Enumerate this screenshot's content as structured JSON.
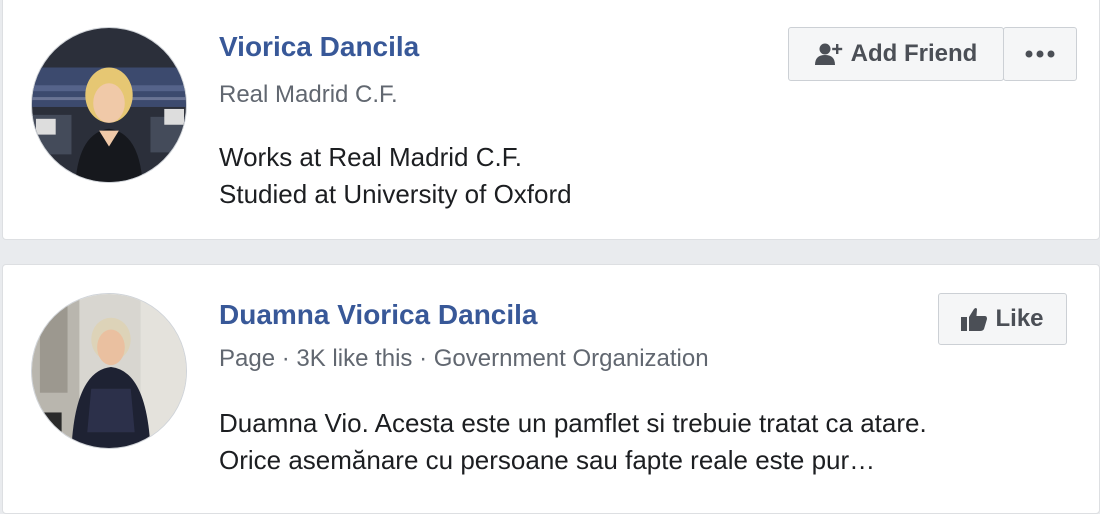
{
  "results": [
    {
      "name": "Viorica Dancila",
      "subtitle": "Real Madrid C.F.",
      "details": [
        "Works at Real Madrid C.F.",
        "Studied at University of Oxford"
      ],
      "action_label": "Add Friend",
      "action_icon": "add-friend-icon",
      "more_icon": "more-icon"
    },
    {
      "name": "Duamna Viorica Dancila",
      "subtitle": "Page · 3K like this · Government Organization",
      "details": [
        "Duamna Vio. Acesta este un pamflet si trebuie tratat ca atare.",
        "Orice asemănare cu persoane sau fapte reale este pur…"
      ],
      "action_label": "Like",
      "action_icon": "thumbs-up-icon"
    }
  ],
  "colors": {
    "name_link": "#385898",
    "secondary_text": "#616770",
    "body_text": "#1c1e21",
    "button_bg": "#f5f6f7",
    "button_text": "#4b4f56",
    "page_bg": "#e9ebee"
  }
}
